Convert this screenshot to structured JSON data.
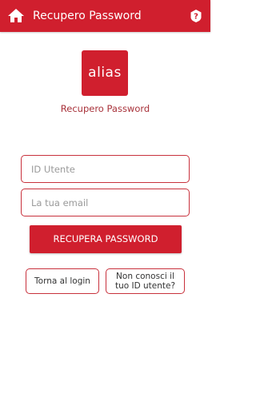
{
  "header": {
    "title": "Recupero Password",
    "home_icon": "home-icon",
    "help_icon": "help-icon",
    "background_color": "#d01f2e"
  },
  "logo": {
    "text": "alias",
    "color": "#d01f2e"
  },
  "subtitle": "Recupero Password",
  "form": {
    "user_id_placeholder": "ID Utente",
    "user_id_value": "",
    "email_placeholder": "La tua email",
    "email_value": "",
    "submit_label": "RECUPERA PASSWORD"
  },
  "links": {
    "back_to_login_label": "Torna al login",
    "forgot_id_label": "Non conosci il tuo ID utente?"
  },
  "colors": {
    "accent": "#d01f2e",
    "border": "#c8313c",
    "subtitle": "#a8323a"
  }
}
